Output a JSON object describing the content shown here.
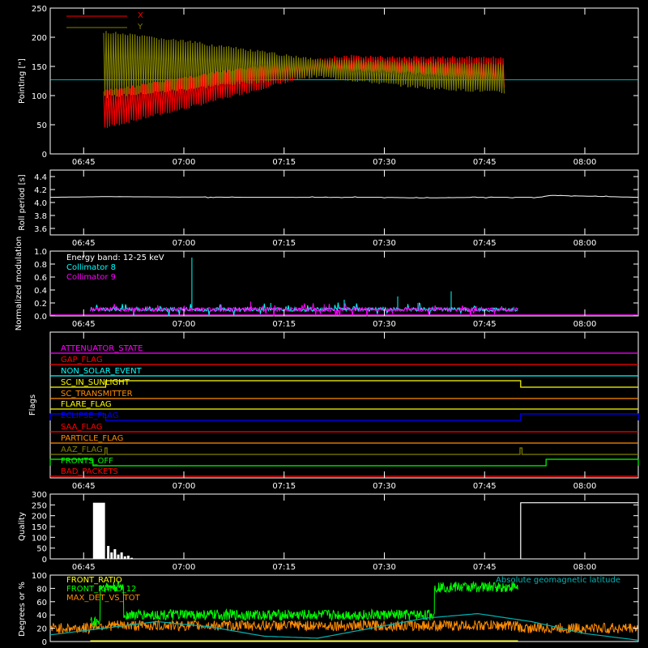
{
  "colors": {
    "background": "#000000",
    "axis": "#ffffff",
    "red": "#ff0000",
    "olive": "#808000",
    "cyan": "#00ffff",
    "magenta": "#ff00ff",
    "green": "#00ff00",
    "orange": "#ff8c00",
    "yellow": "#ffff00",
    "blue": "#0000ff",
    "teal_lat": "#00b4b4"
  },
  "time_axis": {
    "ticks": [
      "06:45",
      "07:00",
      "07:15",
      "07:30",
      "07:45",
      "08:00"
    ],
    "tick_minutes": [
      405,
      420,
      435,
      450,
      465,
      480
    ]
  },
  "chart_data": [
    {
      "type": "area",
      "ylabel": "Pointing [\"]",
      "ylim": [
        0,
        250
      ],
      "yticks": [
        0,
        50,
        100,
        150,
        200,
        250
      ],
      "legend_placement": "top-left",
      "series": [
        {
          "name": "X",
          "color": "red",
          "x": [
            408,
            415,
            420,
            425,
            430,
            435,
            440,
            445,
            450,
            455,
            460,
            465,
            468
          ],
          "min": [
            42,
            62,
            75,
            90,
            105,
            120,
            133,
            140,
            140,
            135,
            130,
            120,
            110
          ],
          "max": [
            110,
            123,
            133,
            142,
            150,
            158,
            166,
            170,
            168,
            168,
            168,
            168,
            166
          ]
        },
        {
          "name": "Y",
          "color": "olive",
          "x": [
            408,
            415,
            420,
            425,
            430,
            435,
            440,
            445,
            450,
            455,
            460,
            465,
            468
          ],
          "min": [
            95,
            102,
            108,
            115,
            120,
            125,
            130,
            124,
            118,
            112,
            108,
            105,
            102
          ],
          "max": [
            212,
            202,
            196,
            188,
            180,
            172,
            165,
            162,
            162,
            160,
            158,
            158,
            156
          ]
        }
      ],
      "reference_y": 127
    },
    {
      "type": "line",
      "ylabel": "Roll period [s]",
      "ylim": [
        3.5,
        4.5
      ],
      "yticks": [
        "3.6",
        "3.8",
        "4.0",
        "4.2",
        "4.4"
      ],
      "series": [
        {
          "name": "",
          "color": "axis",
          "x": [
            400,
            408,
            430,
            450,
            455,
            465,
            473,
            475,
            488
          ],
          "y": [
            4.08,
            4.09,
            4.08,
            4.08,
            4.07,
            4.08,
            4.08,
            4.11,
            4.08
          ]
        }
      ]
    },
    {
      "type": "line",
      "ylabel": "Normalized modulation",
      "ylim": [
        0.0,
        1.0
      ],
      "yticks": [
        "0.0",
        "0.2",
        "0.4",
        "0.6",
        "0.8",
        "1.0"
      ],
      "annotation": "Energy band: 12-25 keV",
      "x_range": [
        406,
        470
      ],
      "base_level": 0.1,
      "series": [
        {
          "name": "Collimator 8",
          "color": "cyan",
          "spikes": [
            [
              421.2,
              0.9
            ],
            [
              444,
              0.25
            ],
            [
              452,
              0.3
            ],
            [
              460,
              0.38
            ],
            [
              433,
              0.2
            ]
          ]
        },
        {
          "name": "Collimator 9",
          "color": "magenta",
          "spikes": [
            [
              430,
              0.22
            ],
            [
              441,
              0.18
            ],
            [
              455,
              0.2
            ]
          ]
        }
      ]
    },
    {
      "type": "line",
      "ylabel": "Flags",
      "flags": [
        {
          "label": "ATTENUATOR_STATE",
          "color": "magenta",
          "on": []
        },
        {
          "label": "GAP_FLAG",
          "color": "red",
          "on": []
        },
        {
          "label": "NON_SOLAR_EVENT",
          "color": "cyan",
          "on": []
        },
        {
          "label": "SC_IN_SUNLIGHT",
          "color": "yellow",
          "on": [
            [
              408.3,
              470.4
            ]
          ]
        },
        {
          "label": "SC_TRANSMITTER",
          "color": "orange",
          "on": []
        },
        {
          "label": "FLARE_FLAG",
          "color": "yellow",
          "on": []
        },
        {
          "label": "ECLIPSE_FLAG",
          "color": "blue",
          "on": [
            [
              400,
              408.3
            ],
            [
              470.4,
              488
            ]
          ]
        },
        {
          "label": "SAA_FLAG",
          "color": "red",
          "on": []
        },
        {
          "label": "PARTICLE_FLAG",
          "color": "orange",
          "on": []
        },
        {
          "label": "AAZ_FLAG",
          "color": "olive",
          "on": [
            [
              408.2,
              408.5
            ],
            [
              470.3,
              470.6
            ]
          ]
        },
        {
          "label": "FRONTS_OFF",
          "color": "green",
          "on": [
            [
              400,
              406.4
            ],
            [
              474.2,
              488
            ]
          ]
        },
        {
          "label": "BAD_PACKETS",
          "color": "red",
          "on": []
        }
      ]
    },
    {
      "type": "bar",
      "ylabel": "Quality",
      "ylim": [
        0,
        300
      ],
      "yticks": [
        0,
        50,
        100,
        150,
        200,
        250,
        300
      ],
      "series": [
        {
          "name": "",
          "color": "axis",
          "x": [
            406.4,
            408.2,
            408.5,
            409,
            409.5,
            410,
            410.5,
            411,
            411.5,
            412,
            470.4,
            488
          ],
          "y": [
            260,
            260,
            60,
            30,
            45,
            20,
            30,
            10,
            15,
            5,
            260,
            260
          ]
        }
      ]
    },
    {
      "type": "line",
      "ylabel": "Degrees or %",
      "ylim": [
        0,
        100
      ],
      "yticks": [
        0,
        20,
        40,
        60,
        80,
        100
      ],
      "series": [
        {
          "name": "FRONT_RATIO",
          "color": "yellow",
          "x": [
            406,
            470
          ],
          "y": [
            0,
            0
          ]
        },
        {
          "name": "FRONT_RATIO_12",
          "color": "green",
          "segments": [
            [
              406,
              407.5,
              30
            ],
            [
              407.5,
              411,
              82
            ],
            [
              411,
              457.5,
              40
            ],
            [
              457.5,
              470,
              82
            ]
          ]
        },
        {
          "name": "MAX_DET_VS_TOT",
          "color": "orange",
          "x": [
            400,
            488
          ],
          "y": [
            25,
            25
          ]
        },
        {
          "name": "Absolute geomagnetic latitude",
          "color": "teal_lat",
          "x": [
            400,
            408,
            416,
            424,
            432,
            440,
            448,
            456,
            464,
            472,
            480,
            488
          ],
          "y": [
            10,
            20,
            30,
            22,
            8,
            5,
            20,
            35,
            42,
            30,
            12,
            2
          ]
        }
      ]
    }
  ]
}
